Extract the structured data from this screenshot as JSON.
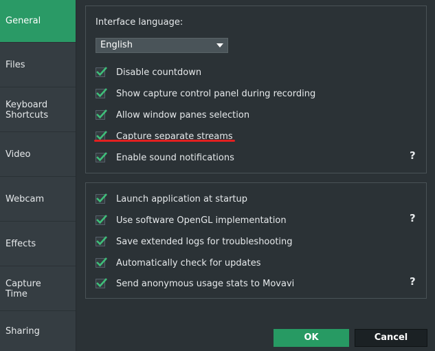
{
  "sidebar": {
    "items": [
      {
        "label": "General",
        "active": true
      },
      {
        "label": "Files"
      },
      {
        "label": "Keyboard\nShortcuts"
      },
      {
        "label": "Video"
      },
      {
        "label": "Webcam"
      },
      {
        "label": "Effects"
      },
      {
        "label": "Capture\nTime"
      },
      {
        "label": "Sharing"
      }
    ]
  },
  "general": {
    "language_label": "Interface language:",
    "language_value": "English",
    "group1": [
      {
        "label": "Disable countdown",
        "checked": true
      },
      {
        "label": "Show capture control panel during recording",
        "checked": true
      },
      {
        "label": "Allow window panes selection",
        "checked": true
      },
      {
        "label": "Capture separate streams",
        "checked": true
      },
      {
        "label": "Enable sound notifications",
        "checked": true
      }
    ],
    "group2": [
      {
        "label": "Launch application at startup",
        "checked": true
      },
      {
        "label": "Use software OpenGL implementation",
        "checked": true
      },
      {
        "label": "Save extended logs for troubleshooting",
        "checked": true
      },
      {
        "label": "Automatically check for updates",
        "checked": true
      },
      {
        "label": "Send anonymous usage stats to Movavi",
        "checked": true
      }
    ],
    "help_glyph": "?"
  },
  "footer": {
    "ok_label": "OK",
    "cancel_label": "Cancel"
  },
  "colors": {
    "accent": "#2a9a66",
    "check": "#3fbf7a",
    "highlight_underline": "#e22020"
  }
}
